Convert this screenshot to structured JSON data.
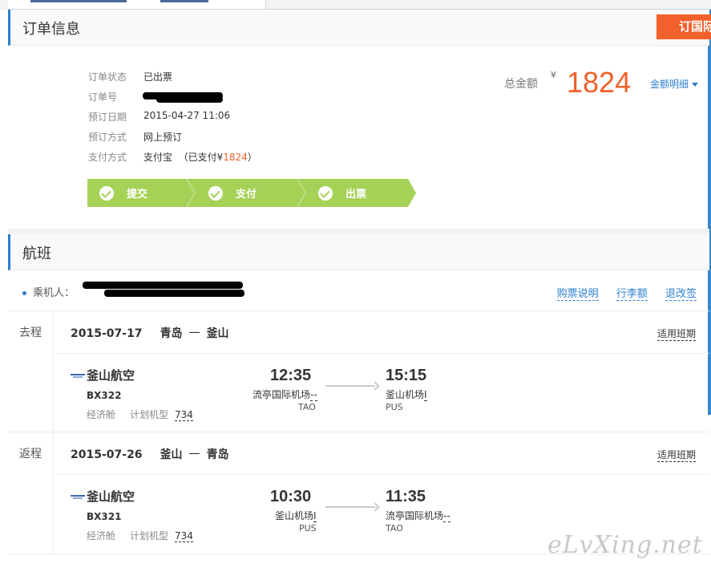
{
  "header": {
    "order_button": "订国际"
  },
  "order_section": {
    "title": "订单信息",
    "fields": [
      {
        "label": "订单状态",
        "value": "已出票"
      },
      {
        "label": "订单号",
        "value": ""
      },
      {
        "label": "预订日期",
        "value": "2015-04-27 11:06"
      },
      {
        "label": "预订方式",
        "value": "网上预订"
      },
      {
        "label": "支付方式",
        "value": "支付宝",
        "note_prefix": "（已支付¥",
        "note_amount": "1824",
        "note_suffix": "）"
      }
    ],
    "progress_steps": [
      "提交",
      "支付",
      "出票"
    ],
    "total": {
      "label": "总金额",
      "currency": "¥",
      "amount": "1824",
      "detail_link": "金额明细"
    }
  },
  "flight_section": {
    "title": "航班",
    "passenger_label": "乘机人：",
    "links": [
      "购票说明",
      "行李额",
      "退改签"
    ],
    "legs": [
      {
        "label": "去程",
        "date": "2015-07-17",
        "from_city": "青岛",
        "to_city": "釜山",
        "dash": "一",
        "applicable": "适用班期",
        "airline": "釜山航空",
        "flight_no": "BX322",
        "cabin": "经济舱",
        "plane_type_label": "计划机型",
        "plane_type": "734",
        "dep_time": "12:35",
        "dep_airport": "流亭国际机场",
        "dep_terminal": "--",
        "dep_code": "TAO",
        "arr_time": "15:15",
        "arr_airport": "釜山机场",
        "arr_terminal": "I",
        "arr_code": "PUS"
      },
      {
        "label": "返程",
        "date": "2015-07-26",
        "from_city": "釜山",
        "to_city": "青岛",
        "dash": "一",
        "applicable": "适用班期",
        "airline": "釜山航空",
        "flight_no": "BX321",
        "cabin": "经济舱",
        "plane_type_label": "计划机型",
        "plane_type": "734",
        "dep_time": "10:30",
        "dep_airport": "釜山机场",
        "dep_terminal": "I",
        "dep_code": "PUS",
        "arr_time": "11:35",
        "arr_airport": "流亭国际机场",
        "arr_terminal": "--",
        "arr_code": "TAO"
      }
    ]
  },
  "watermark": "eLvXing.net",
  "colors": {
    "accent_blue": "#2b7fd0",
    "price_orange": "#f2612b",
    "progress_green": "#a6d157"
  }
}
